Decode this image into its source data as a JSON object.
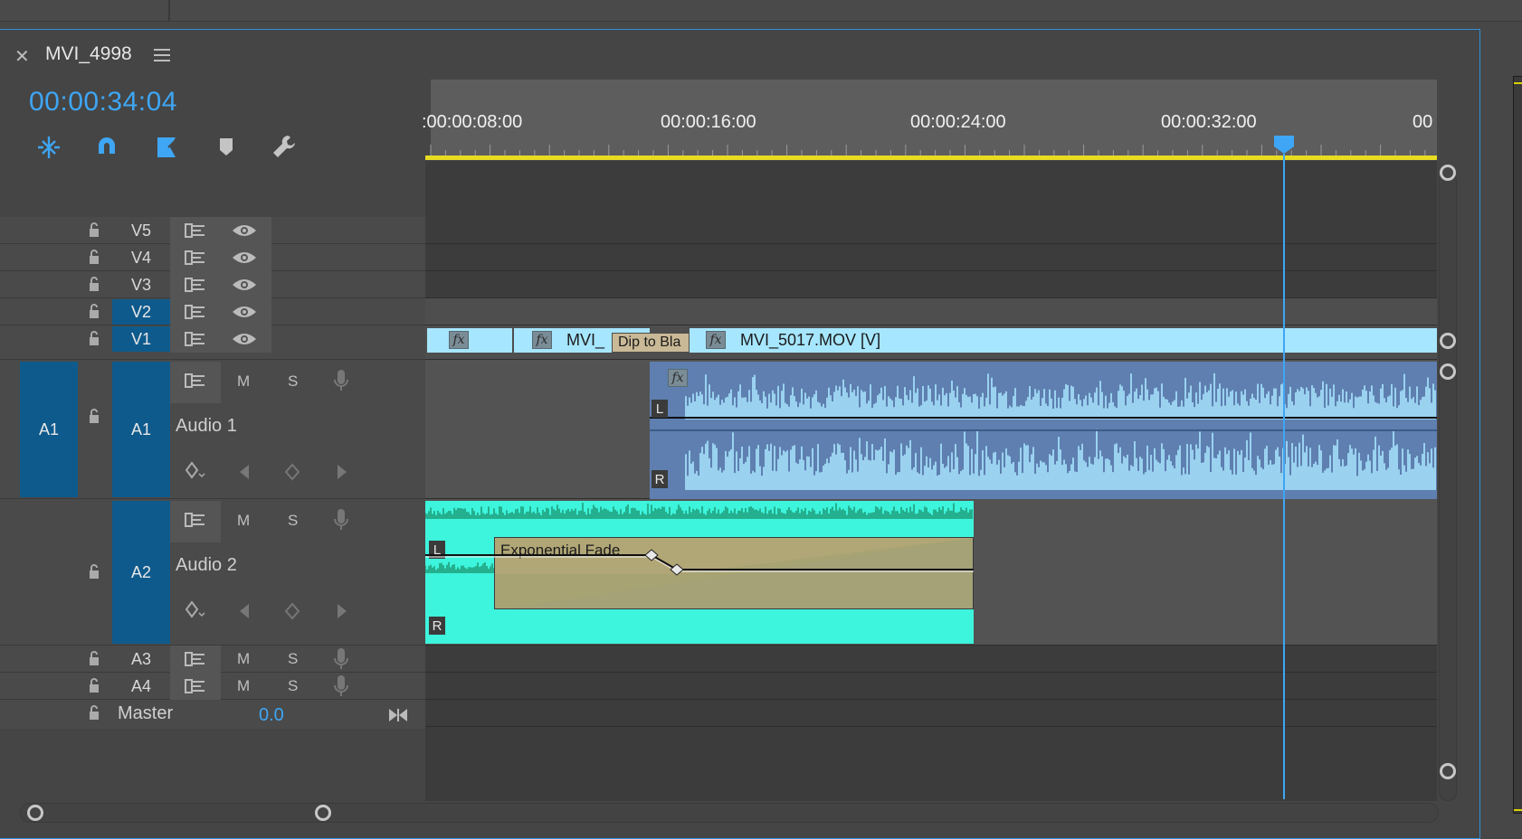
{
  "sequence": {
    "title": "MVI_4998",
    "timecode": "00:00:34:04"
  },
  "ruler": {
    "ticks": [
      ":00:00:08:00",
      "00:00:16:00",
      "00:00:24:00",
      "00:00:32:00",
      "00"
    ]
  },
  "tools": [
    {
      "name": "snap-in-timeline-icon"
    },
    {
      "name": "linked-selection-icon"
    },
    {
      "name": "insert-overwrite-icon"
    },
    {
      "name": "add-marker-icon"
    },
    {
      "name": "timeline-settings-wrench-icon"
    }
  ],
  "tracks": {
    "video": [
      {
        "id": "V5",
        "selected": false
      },
      {
        "id": "V4",
        "selected": false
      },
      {
        "id": "V3",
        "selected": false
      },
      {
        "id": "V2",
        "selected": true
      },
      {
        "id": "V1",
        "selected": true
      }
    ],
    "audio": [
      {
        "source": "A1",
        "id": "A1",
        "name": "Audio 1",
        "mute": "M",
        "solo": "S"
      },
      {
        "source": "",
        "id": "A2",
        "name": "Audio 2",
        "mute": "M",
        "solo": "S"
      },
      {
        "source": "",
        "id": "A3",
        "name": "",
        "mute": "M",
        "solo": "S"
      },
      {
        "source": "",
        "id": "A4",
        "name": "",
        "mute": "M",
        "solo": "S"
      }
    ],
    "master": {
      "label": "Master",
      "value": "0.0"
    }
  },
  "clips": {
    "v1": [
      {
        "label": "",
        "fx": "fx"
      },
      {
        "label": "MVI_",
        "fx": "fx"
      },
      {
        "label": "MVI_5017.MOV [V]",
        "fx": "fx"
      }
    ],
    "transition_label": "Dip to Bla",
    "a1_channels": [
      "L",
      "R"
    ],
    "a1_fx": "fx",
    "a2_channels": [
      "L",
      "R"
    ],
    "a2_transition": "Exponential Fade"
  },
  "colors": {
    "accent": "#3ea6f4",
    "selected_track": "#0e5a8c",
    "video_clip": "#a6e6ff",
    "audio1_clip": "#5e7fb0",
    "audio2_clip": "#3df4dc",
    "work_area": "#e8dc22"
  }
}
